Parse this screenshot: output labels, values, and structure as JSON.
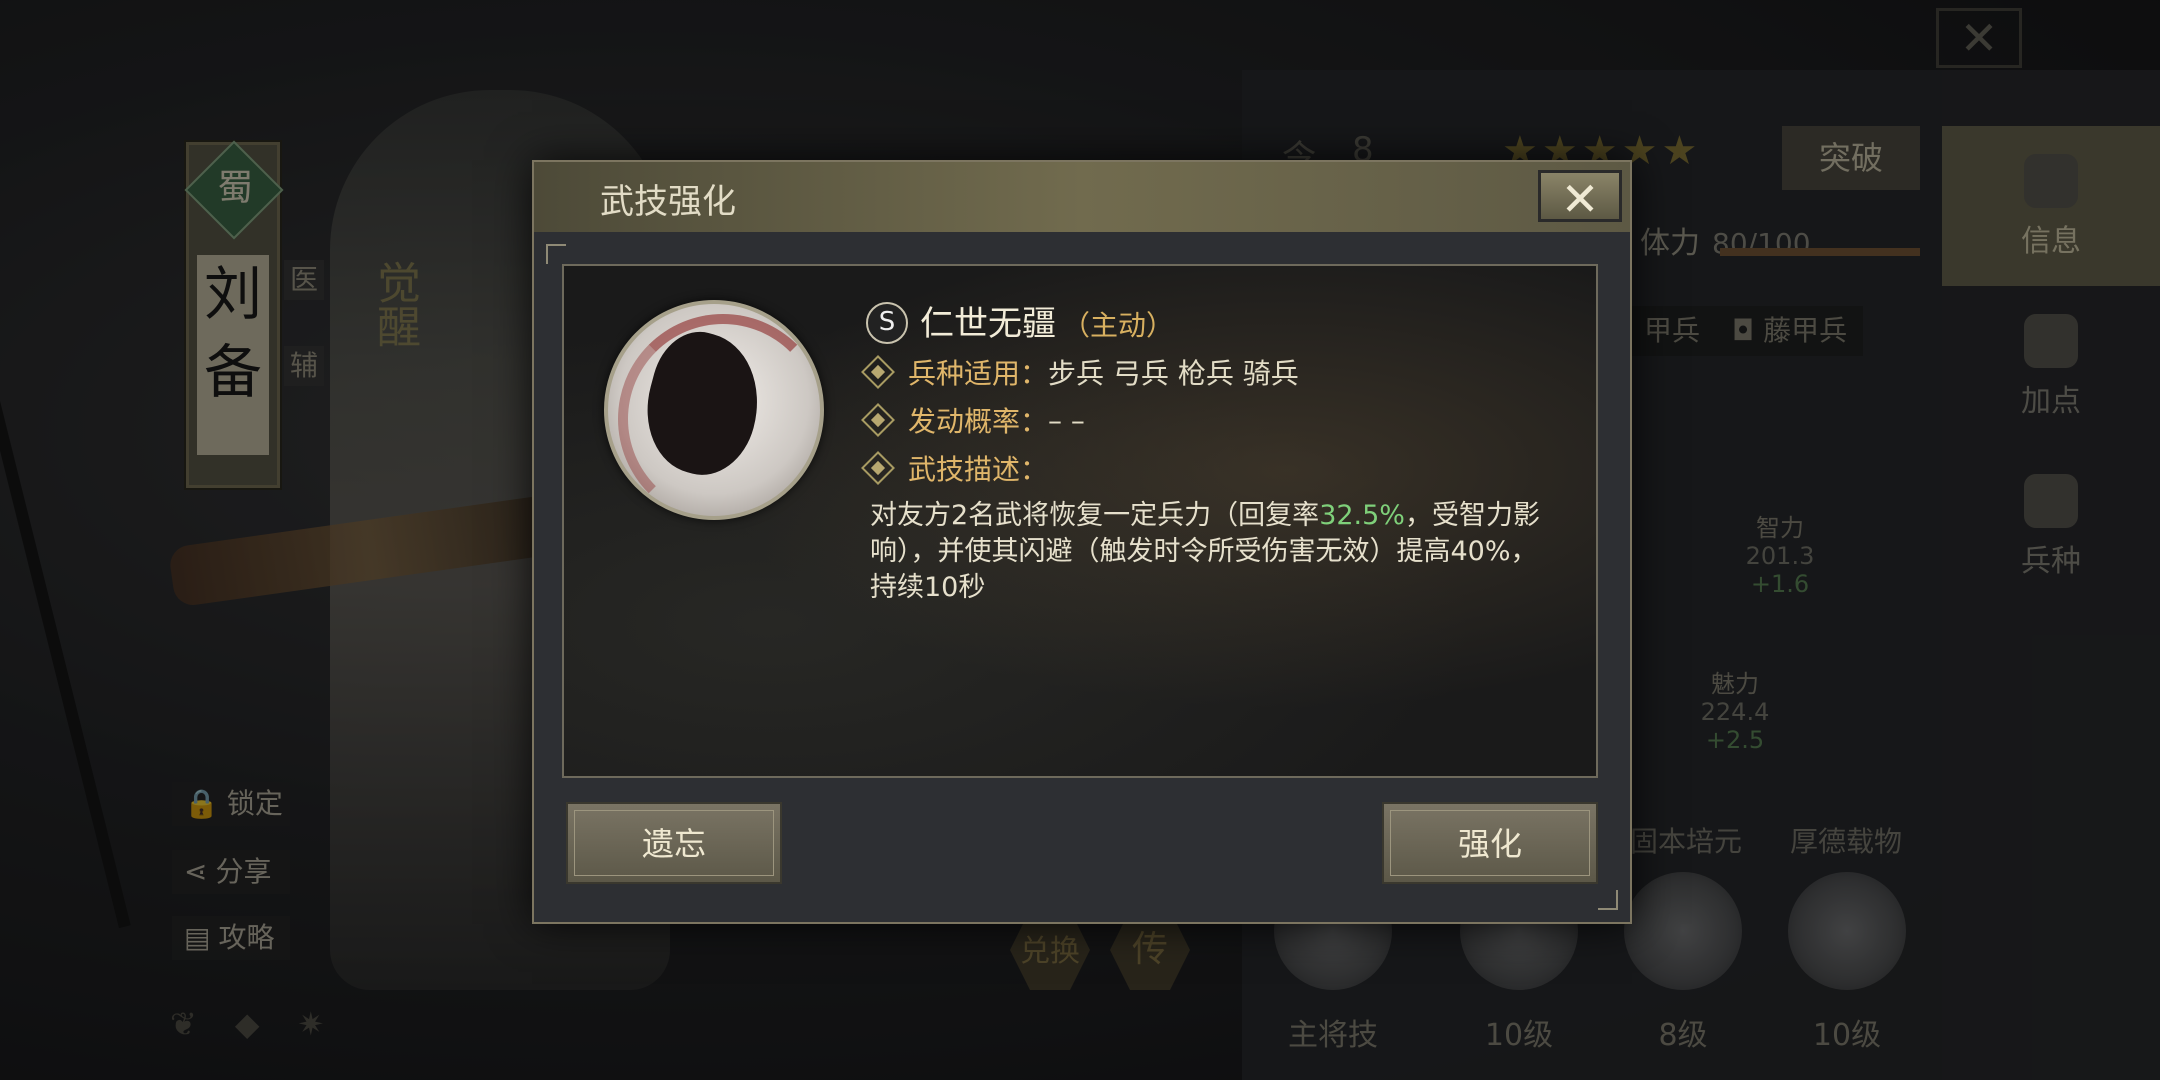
{
  "hero": {
    "faction": "蜀",
    "name": "刘备",
    "role_tags": [
      "医",
      "辅"
    ],
    "awaken_label": "觉醒"
  },
  "left_buttons": [
    {
      "icon": "lock-icon",
      "label": "锁定"
    },
    {
      "icon": "share-icon",
      "label": "分享"
    },
    {
      "icon": "guide-icon",
      "label": "攻略"
    }
  ],
  "top_close": "✕",
  "right_panel": {
    "level_prefix": "令",
    "level": "8",
    "stars": "★★★★★",
    "break_label": "突破",
    "stamina_label": "体力",
    "stamina_value": "80/100",
    "troop_tags": [
      "甲兵",
      "藤甲兵"
    ],
    "stats": [
      {
        "name": "智力",
        "value": "201.3",
        "delta": "+1.6"
      },
      {
        "name": "魅力",
        "value": "224.4",
        "delta": "+2.5"
      }
    ],
    "skill_labels": [
      "固本培元",
      "厚德载物"
    ],
    "skills": [
      {
        "label": "主将技"
      },
      {
        "label": "10级"
      },
      {
        "label": "8级"
      },
      {
        "label": "10级"
      }
    ],
    "exchange_label": "兑换",
    "pass_label": "传"
  },
  "side_tabs": [
    {
      "label": "信息",
      "active": true
    },
    {
      "label": "加点",
      "active": false
    },
    {
      "label": "兵种",
      "active": false
    }
  ],
  "dialog": {
    "title": "武技强化",
    "close": "✕",
    "skill_grade": "S",
    "skill_name": "仁世无疆",
    "skill_type": "（主动）",
    "rows": [
      {
        "label": "兵种适用：",
        "value": "步兵 弓兵 枪兵 骑兵"
      },
      {
        "label": "发动概率：",
        "value": "– –"
      },
      {
        "label": "武技描述：",
        "value": ""
      }
    ],
    "desc_before": "对友方2名武将恢复一定兵力（回复率",
    "desc_highlight": "32.5%",
    "desc_after": "，受智力影响），并使其闪避（触发时令所受伤害无效）提高40%，持续10秒",
    "forget_label": "遗忘",
    "enhance_label": "强化"
  },
  "colors": {
    "accent_gold": "#e0b66a",
    "highlight_green": "#7fd07a",
    "panel_bg": "#2d2f33"
  }
}
